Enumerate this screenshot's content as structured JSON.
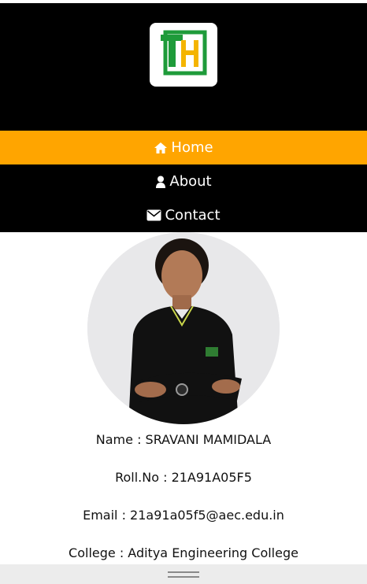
{
  "brand": {
    "logo_alt": "TH"
  },
  "nav": {
    "items": [
      {
        "label": "Home",
        "icon": "home-icon",
        "active": true
      },
      {
        "label": "About",
        "icon": "user-icon",
        "active": false
      },
      {
        "label": "Contact",
        "icon": "envelope-icon",
        "active": false
      }
    ]
  },
  "profile": {
    "photo_alt": "Profile photo",
    "name": "Name : SRAVANI MAMIDALA",
    "roll": "Roll.No : 21A91A05F5",
    "email": "Email : 21a91a05f5@aec.edu.in",
    "college": "College : Aditya Engineering College"
  },
  "colors": {
    "header_bg": "#000000",
    "nav_active": "#ffa500",
    "logo_green": "#1e9b3a",
    "logo_yellow": "#f4b400"
  }
}
